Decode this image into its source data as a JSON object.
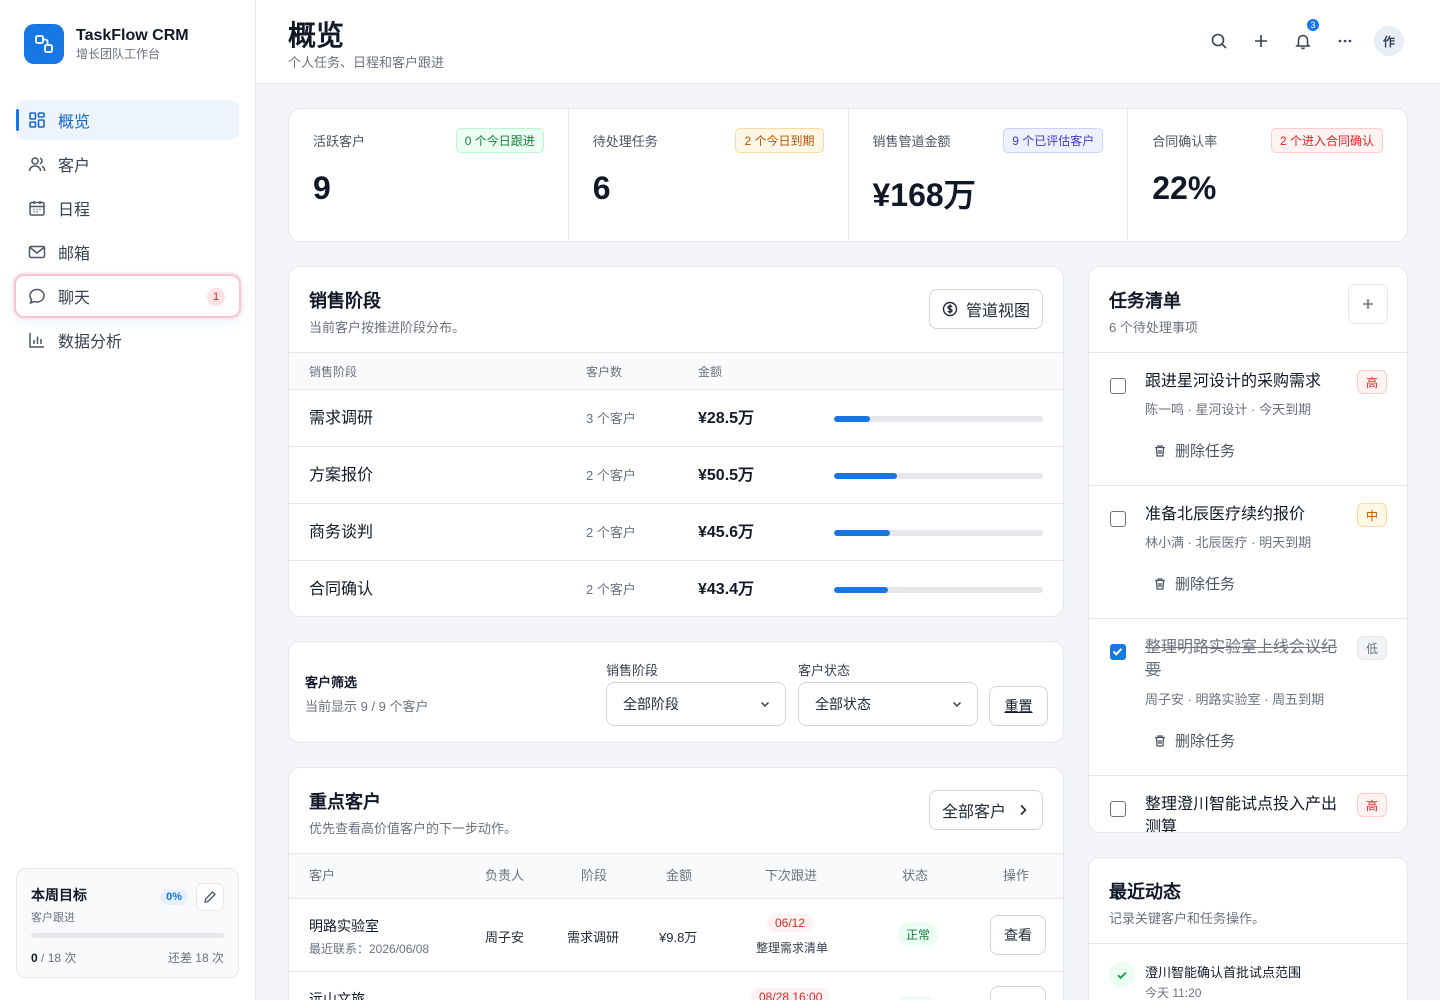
{
  "app": {
    "name": "TaskFlow CRM",
    "subtitle": "增长团队工作台"
  },
  "sidebar": {
    "items": [
      {
        "label": "概览",
        "icon": "grid-icon",
        "active": true
      },
      {
        "label": "客户",
        "icon": "users-icon"
      },
      {
        "label": "日程",
        "icon": "calendar-icon"
      },
      {
        "label": "邮箱",
        "icon": "mail-icon"
      },
      {
        "label": "聊天",
        "icon": "chat-icon",
        "badge": "1"
      },
      {
        "label": "数据分析",
        "icon": "bar-chart-icon"
      }
    ],
    "goal": {
      "title": "本周目标",
      "subtitle": "客户跟进",
      "percent": "0%",
      "progress": 0,
      "done": "0",
      "total": "/ 18 次",
      "remaining": "还差 18 次"
    }
  },
  "header": {
    "title": "概览",
    "subtitle": "个人任务、日程和客户跟进",
    "notification_count": "3",
    "avatar": "作"
  },
  "stats": [
    {
      "label": "活跃客户",
      "value": "9",
      "chip": "0 个今日跟进",
      "tone": "green"
    },
    {
      "label": "待处理任务",
      "value": "6",
      "chip": "2 个今日到期",
      "tone": "amber"
    },
    {
      "label": "销售管道金额",
      "value": "¥168万",
      "chip": "9 个已评估客户",
      "tone": "indigo"
    },
    {
      "label": "合同确认率",
      "value": "22%",
      "chip": "2 个进入合同确认",
      "tone": "red"
    }
  ],
  "stages": {
    "title": "销售阶段",
    "subtitle": "当前客户按推进阶段分布。",
    "button": "管道视图",
    "columns": [
      "销售阶段",
      "客户数",
      "金额"
    ],
    "rows": [
      {
        "name": "需求调研",
        "count": "3 个客户",
        "amount": "¥28.5万",
        "progress": 0.17
      },
      {
        "name": "方案报价",
        "count": "2 个客户",
        "amount": "¥50.5万",
        "progress": 0.3
      },
      {
        "name": "商务谈判",
        "count": "2 个客户",
        "amount": "¥45.6万",
        "progress": 0.27
      },
      {
        "name": "合同确认",
        "count": "2 个客户",
        "amount": "¥43.4万",
        "progress": 0.26
      }
    ]
  },
  "filter": {
    "title": "客户筛选",
    "subtitle": "当前显示 9 / 9 个客户",
    "stage_label": "销售阶段",
    "stage_value": "全部阶段",
    "status_label": "客户状态",
    "status_value": "全部状态",
    "reset": "重置"
  },
  "clients": {
    "title": "重点客户",
    "subtitle": "优先查看高价值客户的下一步动作。",
    "button": "全部客户",
    "columns": [
      "客户",
      "负责人",
      "阶段",
      "金额",
      "下次跟进",
      "状态",
      "操作"
    ],
    "rows": [
      {
        "name": "明路实验室",
        "last": "最近联系：2026/06/08",
        "owner": "周子安",
        "stage": "需求调研",
        "amount": "¥9.8万",
        "date": "06/12",
        "next": "整理需求清单",
        "status": "正常",
        "action": "查看"
      },
      {
        "name": "远山文旅",
        "last": "",
        "owner": "",
        "stage": "",
        "amount": "",
        "date": "08/28 16:00",
        "next": "",
        "status": "",
        "action": ""
      }
    ]
  },
  "tasks": {
    "title": "任务清单",
    "subtitle": "6 个待处理事项",
    "delete_label": "删除任务",
    "items": [
      {
        "title": "跟进星河设计的采购需求",
        "meta": "陈一鸣 · 星河设计 · 今天到期",
        "priority": "高",
        "tone": "high",
        "done": false
      },
      {
        "title": "准备北辰医疗续约报价",
        "meta": "林小满 · 北辰医疗 · 明天到期",
        "priority": "中",
        "tone": "mid",
        "done": false
      },
      {
        "title": "整理明路实验室上线会议纪要",
        "meta": "周子安 · 明路实验室 · 周五到期",
        "priority": "低",
        "tone": "low",
        "done": true
      },
      {
        "title": "整理澄川智能试点投入产出测算",
        "meta": "",
        "priority": "高",
        "tone": "high",
        "done": false
      }
    ]
  },
  "activity": {
    "title": "最近动态",
    "subtitle": "记录关键客户和任务操作。",
    "items": [
      {
        "text": "澄川智能确认首批试点范围",
        "time": "今天 11:20"
      }
    ]
  }
}
